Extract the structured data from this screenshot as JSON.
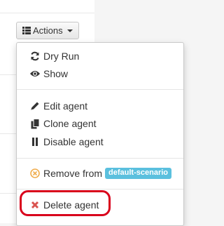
{
  "actions_button": {
    "label": "Actions",
    "icon": "list-icon"
  },
  "menu": {
    "dry_run": {
      "label": "Dry Run",
      "icon": "refresh-icon"
    },
    "show": {
      "label": "Show",
      "icon": "eye-icon"
    },
    "edit_agent": {
      "label": "Edit agent",
      "icon": "pencil-icon"
    },
    "clone_agent": {
      "label": "Clone agent",
      "icon": "copy-icon"
    },
    "disable_agent": {
      "label": "Disable agent",
      "icon": "pause-icon"
    },
    "remove_from": {
      "label": "Remove from",
      "icon": "remove-circle-icon",
      "badge": "default-scenario"
    },
    "delete_agent": {
      "label": "Delete agent",
      "icon": "x-icon"
    }
  },
  "colors": {
    "badge_bg": "#5bc0de",
    "delete_icon": "#d9534f",
    "remove_icon": "#f0ad4e",
    "highlight": "#d9001b"
  }
}
